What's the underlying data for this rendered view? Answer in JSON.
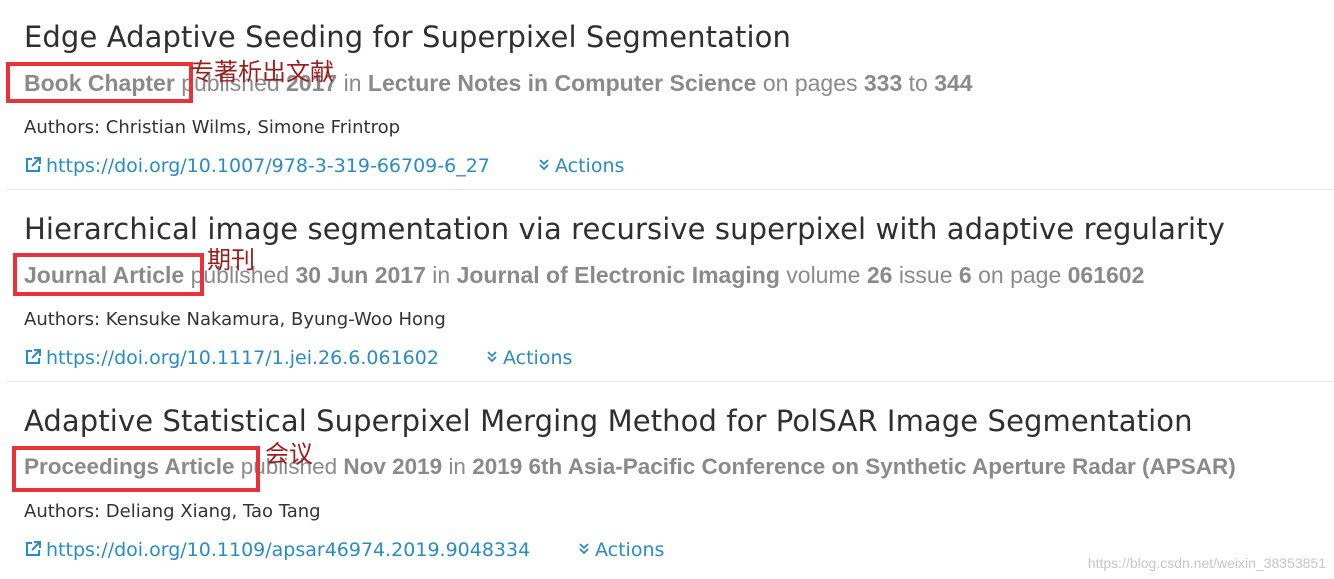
{
  "results": [
    {
      "title": "Edge Adaptive Seeding for Superpixel Segmentation",
      "type": "Book Chapter",
      "published_label": "published",
      "date": "2017",
      "in_label": "in",
      "venue": "Lecture Notes in Computer Science",
      "pages_label": "on pages",
      "page_start": "333",
      "to_label": "to",
      "page_end": "344",
      "authors": "Authors: Christian Wilms, Simone Frintrop",
      "doi": "https://doi.org/10.1007/978-3-319-66709-6_27",
      "actions_label": "Actions",
      "annotation": "专著析出文献"
    },
    {
      "title": "Hierarchical image segmentation via recursive superpixel with adaptive regularity",
      "type": "Journal Article",
      "published_label": "published",
      "date": "30 Jun 2017",
      "in_label": "in",
      "venue": "Journal of Electronic Imaging",
      "volume_label": "volume",
      "volume": "26",
      "issue_label": "issue",
      "issue": "6",
      "page_label": "on page",
      "page": "061602",
      "authors": "Authors: Kensuke Nakamura, Byung-Woo Hong",
      "doi": "https://doi.org/10.1117/1.jei.26.6.061602",
      "actions_label": "Actions",
      "annotation": "期刊"
    },
    {
      "title": "Adaptive Statistical Superpixel Merging Method for PolSAR Image Segmentation",
      "type": "Proceedings Article",
      "published_label": "published",
      "date": "Nov 2019",
      "in_label": "in",
      "venue": "2019 6th Asia-Pacific Conference on Synthetic Aperture Radar (APSAR)",
      "authors": "Authors: Deliang Xiang, Tao Tang",
      "doi": "https://doi.org/10.1109/apsar46974.2019.9048334",
      "actions_label": "Actions",
      "annotation": "会议"
    }
  ],
  "watermark": "https://blog.csdn.net/weixin_38353851",
  "colors": {
    "link": "#2b8bc2",
    "highlight": "#e8323b",
    "annotation": "#9a1f1f",
    "meta": "#8a8a8a"
  },
  "icons": {
    "link": "external-link-icon",
    "actions": "chevron-double-down-icon"
  }
}
